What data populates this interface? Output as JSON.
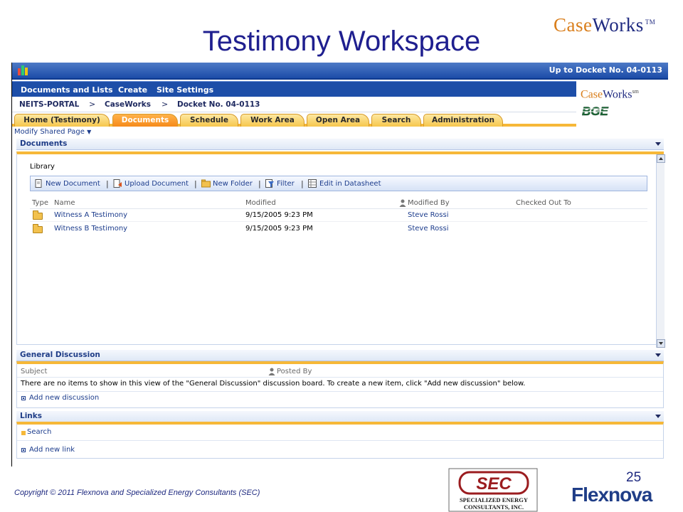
{
  "slide": {
    "title": "Testimony Workspace",
    "brand_case": "Case",
    "brand_works": "Works",
    "brand_tm": "TM",
    "page_number": "25",
    "copyright": "Copyright © 2011 Flexnova and Specialized Energy Consultants (SEC)",
    "flexnova": "Flexnova",
    "sec_lines": [
      "SEC",
      "Specialized Energy",
      "Consultants, Inc."
    ]
  },
  "app": {
    "top_link": "Up to Docket No. 04-0113",
    "menu": [
      "Documents and Lists",
      "Create",
      "Site Settings"
    ],
    "breadcrumb": [
      "NEITS-PORTAL",
      "CaseWorks",
      "Docket No. 04-0113"
    ],
    "breadcrumb_sep": ">",
    "brand_small_case": "Case",
    "brand_small_works": "Works",
    "brand_small_sm": "sm",
    "bge": "BGE",
    "tabs": [
      {
        "label": "Home (Testimony)",
        "active": false
      },
      {
        "label": "Documents",
        "active": true
      },
      {
        "label": "Schedule",
        "active": false
      },
      {
        "label": "Work Area",
        "active": false
      },
      {
        "label": "Open Area",
        "active": false
      },
      {
        "label": "Search",
        "active": false
      },
      {
        "label": "Administration",
        "active": false
      }
    ],
    "modify_shared_page": "Modify Shared Page",
    "accent_color": "#f68a1a"
  },
  "documents": {
    "header": "Documents",
    "library_label": "Library",
    "toolbar": [
      "New Document",
      "Upload Document",
      "New Folder",
      "Filter",
      "Edit in Datasheet"
    ],
    "columns": [
      "Type",
      "Name",
      "Modified",
      "Modified By",
      "Checked Out To"
    ],
    "rows": [
      {
        "name": "Witness A Testimony",
        "modified": "9/15/2005 9:23 PM",
        "modified_by": "Steve Rossi",
        "checked_out_to": ""
      },
      {
        "name": "Witness B Testimony",
        "modified": "9/15/2005 9:23 PM",
        "modified_by": "Steve Rossi",
        "checked_out_to": ""
      }
    ]
  },
  "general_discussion": {
    "header": "General Discussion",
    "col_subject": "Subject",
    "col_posted_by": "Posted By",
    "empty_message": "There are no items to show in this view of the \"General Discussion\" discussion board. To create a new item, click \"Add new discussion\" below.",
    "add_link": "Add new discussion"
  },
  "links": {
    "header": "Links",
    "items": [
      "Search"
    ],
    "add_link": "Add new link"
  }
}
